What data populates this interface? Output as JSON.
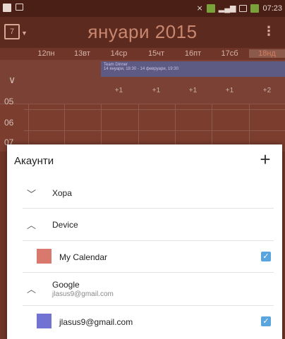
{
  "status_bar": {
    "time": "07:23"
  },
  "app_bar": {
    "calendar_button_label": "7",
    "title": "януари 2015"
  },
  "week_header": {
    "days": [
      {
        "label": "12пн"
      },
      {
        "label": "13вт"
      },
      {
        "label": "14ср"
      },
      {
        "label": "15чт"
      },
      {
        "label": "16пт"
      },
      {
        "label": "17сб"
      },
      {
        "label": "18нд"
      }
    ]
  },
  "all_day": {
    "event": {
      "title": "Team Dinner",
      "time": "14 януари, 18:30 - 14 февруари, 19:30"
    },
    "overflow": [
      "+1",
      "+1",
      "+1",
      "+1",
      "+2"
    ]
  },
  "hours": [
    "05",
    "06",
    "07"
  ],
  "dialog": {
    "title": "Акаунти",
    "add_label": "+",
    "groups": [
      {
        "name": "Хора",
        "expanded": false
      },
      {
        "name": "Device",
        "expanded": true
      },
      {
        "name": "Google",
        "account": "jlasus9@gmail.com",
        "expanded": true
      }
    ],
    "calendars": [
      {
        "name": "My Calendar",
        "color": "#d9786c",
        "checked": true
      },
      {
        "name": "jlasus9@gmail.com",
        "color": "#7172d1",
        "checked": true
      }
    ]
  },
  "colors": {
    "accent_checkbox": "#5aa5de"
  }
}
